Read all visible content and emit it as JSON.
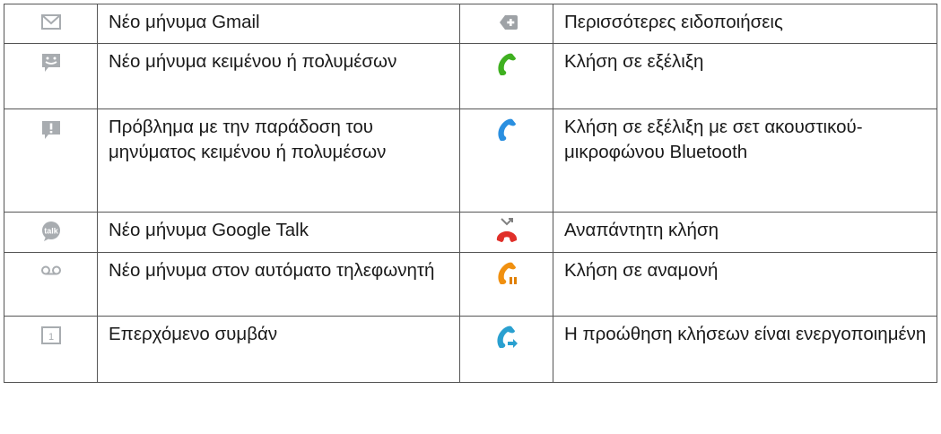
{
  "rows": [
    {
      "left": {
        "icon": "gmail-envelope-icon",
        "text": "Νέο μήνυμα Gmail"
      },
      "right": {
        "icon": "more-notifications-icon",
        "text": "Περισσότερες ειδοποιήσεις"
      }
    },
    {
      "left": {
        "icon": "sms-mms-message-icon",
        "text": "Νέο μήνυμα κειμένου ή πολυμέσων"
      },
      "right": {
        "icon": "call-in-progress-icon",
        "text": "Κλήση σε εξέλιξη"
      }
    },
    {
      "left": {
        "icon": "message-delivery-problem-icon",
        "text": "Πρόβλημα με την παράδοση του μηνύματος κειμένου ή πολυμέσων"
      },
      "right": {
        "icon": "bluetooth-call-icon",
        "text": "Κλήση σε εξέλιξη με σετ ακουστικού-μικροφώνου Bluetooth"
      }
    },
    {
      "left": {
        "icon": "google-talk-icon",
        "icon_text": "talk",
        "text": "Νέο μήνυμα Google Talk"
      },
      "right": {
        "icon": "missed-call-icon",
        "text": "Αναπάντητη κλήση"
      }
    },
    {
      "left": {
        "icon": "voicemail-icon",
        "text": "Νέο μήνυμα στον αυτόματο τηλεφωνητή"
      },
      "right": {
        "icon": "call-on-hold-icon",
        "text": "Κλήση σε αναμονή"
      }
    },
    {
      "left": {
        "icon": "calendar-event-icon",
        "icon_text": "1",
        "text": "Επερχόμενο συμβάν"
      },
      "right": {
        "icon": "call-forwarding-icon",
        "text": "Η προώθηση κλήσεων είναι ενεργοποιημένη"
      }
    }
  ],
  "colors": {
    "border": "#555555",
    "icon_gray": "#a8acb0",
    "call_green": "#3fb020",
    "call_blue": "#2a8fe0",
    "missed_red": "#e0302a",
    "hold_orange": "#f09010",
    "forward_teal": "#2aa0d0"
  }
}
